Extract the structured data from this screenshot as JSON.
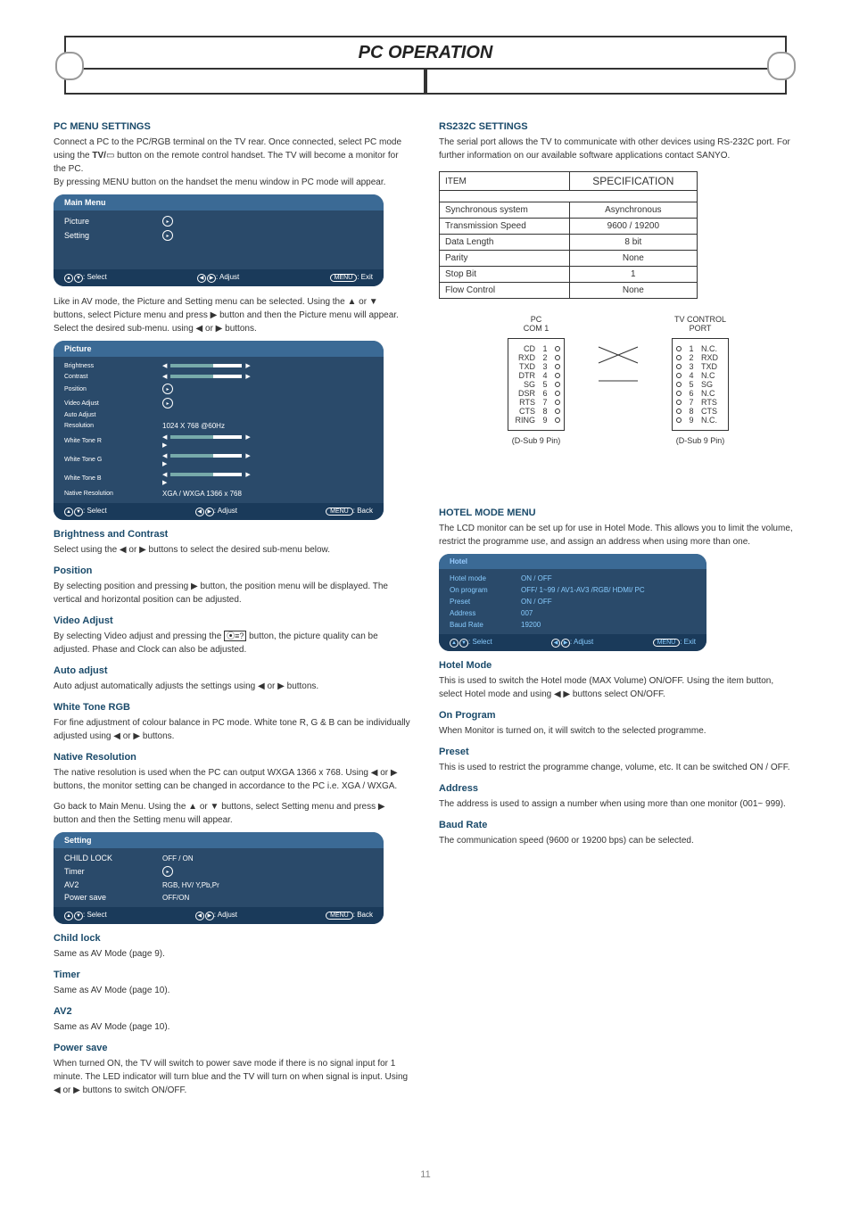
{
  "header": {
    "title": "PC OPERATION"
  },
  "left": {
    "sec1": {
      "title": "PC MENU SETTINGS",
      "l1": "Connect a PC to the PC/RGB terminal on the TV rear. Once connected, select PC mode using the ",
      "tv_bold": "TV/",
      "l1b": " button on the remote control handset. The TV will become a monitor for the PC.",
      "l2": "By pressing MENU button on the handset the menu window in PC mode will appear."
    },
    "osd1": {
      "title": "Main Menu",
      "items": [
        "Picture",
        "Setting"
      ],
      "ftr": {
        "sel": ": Select",
        "adj": ": Adjust",
        "exit": ": Exit",
        "menuKey": "MENU"
      }
    },
    "para_pic_intro": "Like in AV mode, the Picture and Setting menu can be selected. Using the ▲ or ▼ buttons, select Picture menu and press ▶ button and then the Picture menu will appear. Select the desired sub-menu. using ◀ or ▶ buttons.",
    "osd2": {
      "title": "Picture",
      "rows": [
        {
          "lbl": "Brightness",
          "type": "bar"
        },
        {
          "lbl": "Contrast",
          "type": "bar"
        },
        {
          "lbl": "Position",
          "type": "play"
        },
        {
          "lbl": "Video Adjust",
          "type": "play"
        },
        {
          "lbl": "Auto Adjust",
          "type": "none"
        },
        {
          "lbl": "Resolution",
          "type": "text",
          "val": "1024 X 768    @60Hz"
        },
        {
          "lbl": "White Tone R",
          "type": "barsmall"
        },
        {
          "lbl": "White Tone G",
          "type": "barsmall"
        },
        {
          "lbl": "White Tone B",
          "type": "barsmall"
        },
        {
          "lbl": "Native Resolution",
          "type": "text",
          "val": "XGA / WXGA 1366 x 768"
        }
      ],
      "ftr": {
        "sel": ": Select",
        "adj": ": Adjust",
        "back": ": Back",
        "menuKey": "MENU"
      }
    },
    "bc": {
      "h": "Brightness and Contrast",
      "t": "Select using the ◀ or ▶ buttons to select the desired sub-menu below."
    },
    "pos": {
      "h": "Position",
      "t": "By selecting position and pressing ▶ button, the position menu will be displayed. The vertical and horizontal position can be adjusted."
    },
    "va": {
      "h": "Video Adjust",
      "t": "By selecting Video adjust and pressing the ",
      "icon_desc": "teletext",
      "t2": " button, the picture quality can be adjusted. Phase and Clock can also be adjusted."
    },
    "aa": {
      "h": "Auto adjust",
      "t": "Auto adjust automatically adjusts the settings using ◀ or ▶ buttons."
    },
    "wt": {
      "h": "White Tone RGB",
      "t": "For fine adjustment of colour balance in PC mode. White tone R, G & B can be individually adjusted using ◀ or ▶ buttons."
    },
    "nr": {
      "h": "Native Resolution",
      "t": "The native resolution is used when the PC can output WXGA 1366 x 768. Using ◀ or ▶ buttons, the monitor setting can be changed in accordance to the PC i.e. XGA / WXGA."
    },
    "set_intro": "Go back to Main Menu. Using the ▲ or ▼ buttons, select Setting menu and press ▶ button and then the Setting menu will appear.",
    "osd3": {
      "title": "Setting",
      "rows": [
        {
          "lbl": "CHILD LOCK",
          "val": "OFF / ON"
        },
        {
          "lbl": "Timer",
          "val": "play"
        },
        {
          "lbl": "AV2",
          "val": "RGB, HV/ Y,Pb,Pr"
        },
        {
          "lbl": "Power save",
          "val": "OFF/ON"
        }
      ],
      "ftr": {
        "sel": ": Select",
        "adj": ": Adjust",
        "back": ": Back",
        "menuKey": "MENU"
      }
    },
    "cl": {
      "h": "Child lock",
      "t": "Same as AV Mode (page 9)."
    },
    "tm": {
      "h": "Timer",
      "t": "Same as AV Mode (page 10)."
    },
    "av2": {
      "h": "AV2",
      "t": "Same as AV Mode (page 10)."
    },
    "ps": {
      "h": "Power save",
      "t": "When turned ON, the TV will switch to power save mode if there is no signal input for 1 minute. The LED indicator will turn blue and the TV will turn on when signal is input. Using ◀ or ▶ buttons to switch ON/OFF."
    }
  },
  "right": {
    "sec": {
      "title": "RS232C SETTINGS",
      "t": "The serial port allows the TV to communicate with other devices using RS-232C port. For further information on our available software applications contact SANYO."
    },
    "spec": {
      "h1": "ITEM",
      "h2": "SPECIFICATION",
      "rows": [
        [
          "Synchronous system",
          "Asynchronous"
        ],
        [
          "Transmission Speed",
          "9600 / 19200"
        ],
        [
          "Data Length",
          "8 bit"
        ],
        [
          "Parity",
          "None"
        ],
        [
          "Stop Bit",
          "1"
        ],
        [
          "Flow Control",
          "None"
        ]
      ]
    },
    "pins": {
      "left_title": "PC\nCOM 1",
      "right_title": "TV CONTROL\nPORT",
      "left": [
        {
          "lbl": "CD",
          "n": "1"
        },
        {
          "lbl": "RXD",
          "n": "2"
        },
        {
          "lbl": "TXD",
          "n": "3"
        },
        {
          "lbl": "DTR",
          "n": "4"
        },
        {
          "lbl": "SG",
          "n": "5"
        },
        {
          "lbl": "DSR",
          "n": "6"
        },
        {
          "lbl": "RTS",
          "n": "7"
        },
        {
          "lbl": "CTS",
          "n": "8"
        },
        {
          "lbl": "RING",
          "n": "9"
        }
      ],
      "right": [
        {
          "n": "1",
          "lbl": "N.C."
        },
        {
          "n": "2",
          "lbl": "RXD"
        },
        {
          "n": "3",
          "lbl": "TXD"
        },
        {
          "n": "4",
          "lbl": "N.C"
        },
        {
          "n": "5",
          "lbl": "SG"
        },
        {
          "n": "6",
          "lbl": "N.C"
        },
        {
          "n": "7",
          "lbl": "RTS"
        },
        {
          "n": "8",
          "lbl": "CTS"
        },
        {
          "n": "9",
          "lbl": "N.C."
        }
      ],
      "cap": "(D-Sub  9 Pin)"
    },
    "hotel_sec": {
      "title": "HOTEL MODE MENU",
      "t1": "The LCD monitor can be set up for use in Hotel Mode. This allows you to limit the volume, restrict the programme use, and assign an address when using more than one."
    },
    "hotel_osd": {
      "title": "Hotel",
      "rows": [
        {
          "lbl": "Hotel mode",
          "val": "ON / OFF"
        },
        {
          "lbl": "On program",
          "val": "OFF/ 1~99 / AV1-AV3 /RGB/ HDMI/ PC"
        },
        {
          "lbl": "Preset",
          "val": "ON / OFF"
        },
        {
          "lbl": "Address",
          "val": "007"
        },
        {
          "lbl": "Baud Rate",
          "val": "19200"
        }
      ],
      "ftr": {
        "sel": ": Select",
        "adj": ": Adjust",
        "exit": ": Exit",
        "menuKey": "MENU"
      }
    },
    "hm": {
      "h": "Hotel Mode",
      "t": "This is used to switch the Hotel mode (MAX Volume) ON/OFF. Using the item button, select Hotel mode and using ◀ ▶ buttons select ON/OFF."
    },
    "op": {
      "h": "On Program",
      "t": "When Monitor is turned on, it will switch to the selected programme."
    },
    "pr": {
      "h": "Preset",
      "t": "This is used to restrict the programme change, volume, etc. It can be switched ON / OFF."
    },
    "ad": {
      "h": "Address",
      "t": "The address is used to assign a number when using more than one monitor (001~ 999)."
    },
    "br": {
      "h": "Baud Rate",
      "t": "The communication speed (9600 or 19200 bps) can be selected."
    }
  },
  "pagefoot": "11"
}
